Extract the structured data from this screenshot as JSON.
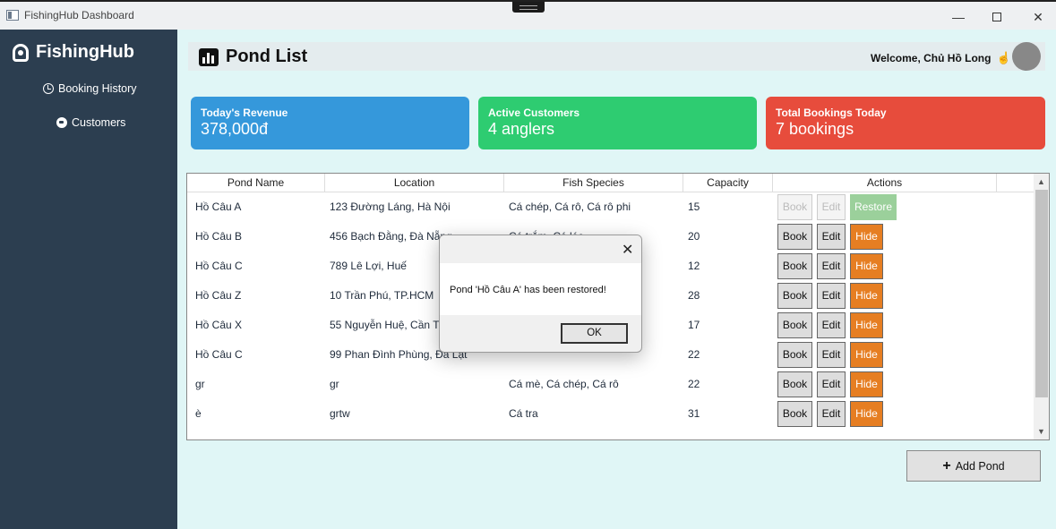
{
  "window": {
    "title": "FishingHub Dashboard"
  },
  "sidebar": {
    "brand": "FishingHub",
    "items": [
      {
        "label": "Booking History",
        "icon": "clock-icon"
      },
      {
        "label": "Customers",
        "icon": "user-icon"
      }
    ]
  },
  "header": {
    "title": "Pond List",
    "welcome": "Welcome, Chủ Hồ Long"
  },
  "stats": {
    "revenue": {
      "label": "Today's Revenue",
      "value": "378,000đ",
      "color": "#3598db"
    },
    "customers": {
      "label": "Active Customers",
      "value": "4 anglers",
      "color": "#2ecc71"
    },
    "bookings": {
      "label": "Total Bookings Today",
      "value": "7 bookings",
      "color": "#e74c3c"
    }
  },
  "table": {
    "columns": [
      "Pond Name",
      "Location",
      "Fish Species",
      "Capacity",
      "Actions"
    ],
    "rows": [
      {
        "name": "Hồ Câu A",
        "location": "123 Đường Láng, Hà Nội",
        "species": "Cá chép, Cá rô, Cá rô phi",
        "capacity": "15",
        "status": "hidden"
      },
      {
        "name": "Hồ Câu B",
        "location": "456 Bạch Đằng, Đà Nẵng",
        "species": "Cá trắm, Cá lóc",
        "capacity": "20",
        "status": "active"
      },
      {
        "name": "Hồ Câu C",
        "location": "789 Lê Lợi, Huế",
        "species": "",
        "capacity": "12",
        "status": "active"
      },
      {
        "name": "Hồ Câu Z",
        "location": "10 Trần Phú, TP.HCM",
        "species": "",
        "capacity": "28",
        "status": "active"
      },
      {
        "name": "Hồ Câu X",
        "location": "55 Nguyễn Huệ, Cần Thơ",
        "species": "",
        "capacity": "17",
        "status": "active"
      },
      {
        "name": "Hồ Câu C",
        "location": "99 Phan Đình Phùng, Đà Lạt",
        "species": "",
        "capacity": "22",
        "status": "active"
      },
      {
        "name": "gr",
        "location": "gr",
        "species": "Cá mè, Cá chép, Cá rô",
        "capacity": "22",
        "status": "active"
      },
      {
        "name": "è",
        "location": "grtw",
        "species": "Cá tra",
        "capacity": "31",
        "status": "active"
      }
    ],
    "actions": {
      "book": "Book",
      "edit": "Edit",
      "hide": "Hide",
      "restore": "Restore"
    }
  },
  "add_pond": {
    "label": "Add Pond"
  },
  "dialog": {
    "message": "Pond 'Hồ Câu A' has been restored!",
    "ok_label": "OK"
  }
}
